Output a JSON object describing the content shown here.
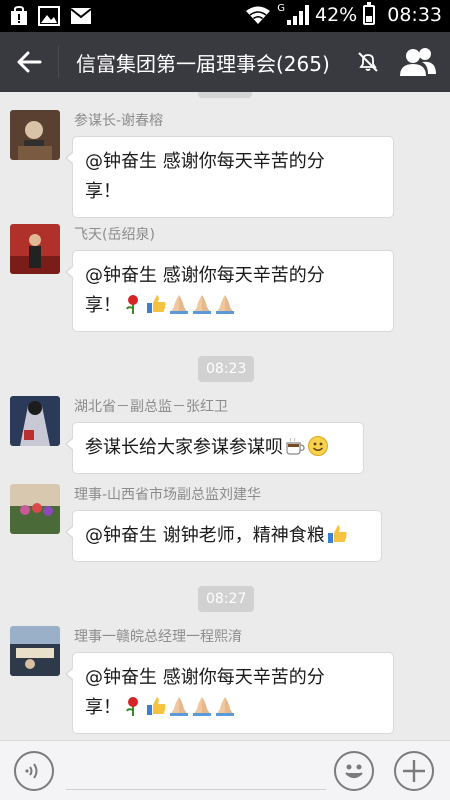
{
  "status_bar": {
    "network_type": "G",
    "battery": "42%",
    "battery_level": 0.42,
    "time": "08:33",
    "icons": [
      "bag-warning-icon",
      "image-icon",
      "mail-icon",
      "wifi-icon",
      "signal-icon",
      "battery-icon"
    ]
  },
  "header": {
    "title": "信富集团第一届理事会(265)",
    "icons": [
      "back-arrow-icon",
      "mute-icon",
      "group-members-icon"
    ]
  },
  "messages": [
    {
      "sender": "参谋长-谢春榕",
      "text_lines": [
        "@钟奋生 感谢你每天辛苦的分",
        "享！"
      ],
      "emojis": []
    },
    {
      "sender": "飞天(岳绍泉)",
      "text_lines": [
        "@钟奋生 感谢你每天辛苦的分",
        "享！"
      ],
      "emojis": [
        "rose",
        "thumbs-up",
        "pray",
        "pray",
        "pray"
      ]
    },
    {
      "time": "08:23"
    },
    {
      "sender": "湖北省－副总监－张红卫",
      "text_lines": [
        "参谋长给大家参谋参谋呗"
      ],
      "emojis": [
        "coffee",
        "smile"
      ]
    },
    {
      "sender": "理事-山西省市场副总监刘建华",
      "text_lines": [
        "@钟奋生 谢钟老师，精神食粮"
      ],
      "emojis": [
        "thumbs-up"
      ]
    },
    {
      "time": "08:27"
    },
    {
      "sender": "理事一赣皖总经理一程熙淯",
      "text_lines": [
        "@钟奋生 感谢你每天辛苦的分",
        "享！"
      ],
      "emojis": [
        "rose",
        "thumbs-up",
        "pray",
        "pray",
        "pray"
      ]
    }
  ],
  "input_bar": {
    "icons": [
      "voice-icon",
      "emoji-icon",
      "plus-icon"
    ]
  },
  "colors": {
    "title_bar": "#393a3f",
    "chat_bg": "#ebebeb",
    "bubble": "#ffffff",
    "sender_text": "#8c8c8c"
  }
}
